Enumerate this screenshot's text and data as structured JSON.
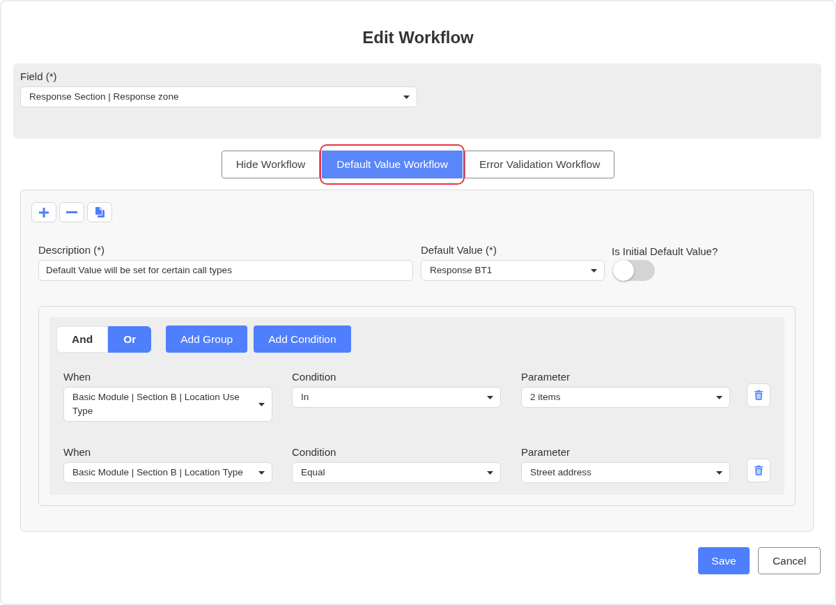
{
  "dialog": {
    "title": "Edit Workflow"
  },
  "field": {
    "label": "Field (*)",
    "value": "Response Section | Response zone"
  },
  "tabs": [
    {
      "label": "Hide Workflow",
      "selected": false,
      "highlighted": false
    },
    {
      "label": "Default Value Workflow",
      "selected": true,
      "highlighted": true
    },
    {
      "label": "Error Validation Workflow",
      "selected": false,
      "highlighted": false
    }
  ],
  "workflow": {
    "description": {
      "label": "Description (*)",
      "value": "Default Value will be set for certain call types"
    },
    "default_value": {
      "label": "Default Value (*)",
      "value": "Response BT1"
    },
    "initial_default": {
      "label": "Is Initial Default Value?",
      "on": false
    },
    "group": {
      "operators": [
        {
          "label": "And",
          "selected": false
        },
        {
          "label": "Or",
          "selected": true
        }
      ],
      "buttons": [
        "Add Group",
        "Add Condition"
      ],
      "conditions": [
        {
          "when": {
            "label": "When",
            "value": "Basic Module | Section B | Location Use Type"
          },
          "condition": {
            "label": "Condition",
            "value": "In"
          },
          "parameter": {
            "label": "Parameter",
            "value": "2 items"
          }
        },
        {
          "when": {
            "label": "When",
            "value": "Basic Module | Section B | Location Type"
          },
          "condition": {
            "label": "Condition",
            "value": "Equal"
          },
          "parameter": {
            "label": "Parameter",
            "value": "Street address"
          }
        }
      ]
    }
  },
  "buttons": [
    {
      "label": "Save",
      "kind": "primary"
    },
    {
      "label": "Cancel",
      "kind": "secondary"
    }
  ]
}
